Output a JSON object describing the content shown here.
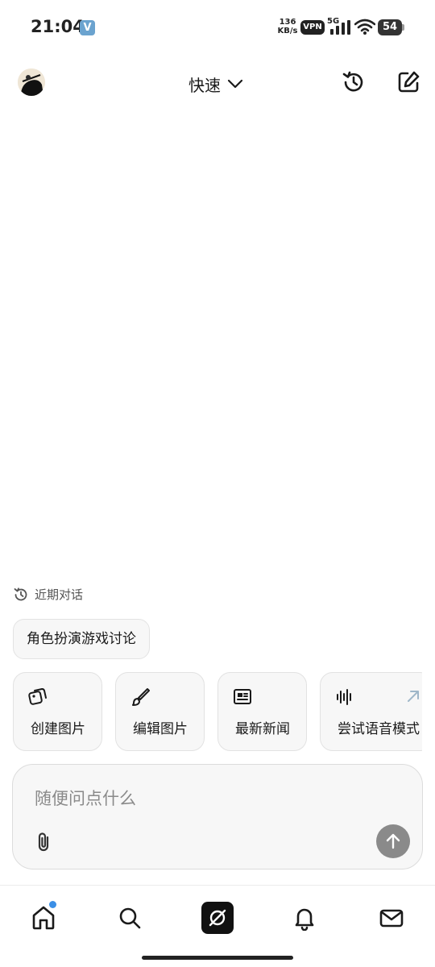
{
  "status_bar": {
    "time": "21:04",
    "v_badge": "V",
    "speed_value": "136",
    "speed_unit": "KB/s",
    "vpn": "VPN",
    "network": "5G",
    "battery": "54",
    "signal_icon": "signal-bars-icon",
    "wifi_icon": "wifi-icon"
  },
  "header": {
    "mode_label": "快速",
    "dropdown_icon": "chevron-down-icon",
    "history_icon": "history-icon",
    "new_chat_icon": "edit-icon"
  },
  "recent": {
    "label": "近期对话",
    "items": [
      "角色扮演游戏讨论"
    ]
  },
  "quick_actions": [
    {
      "label": "创建图片",
      "icon": "image-create-icon"
    },
    {
      "label": "编辑图片",
      "icon": "brush-icon"
    },
    {
      "label": "最新新闻",
      "icon": "newspaper-icon"
    },
    {
      "label": "尝试语音模式",
      "icon": "voice-wave-icon"
    }
  ],
  "composer": {
    "placeholder": "随便问点什么",
    "value": "",
    "attach_icon": "paperclip-icon",
    "send_icon": "arrow-up-icon"
  },
  "bottom_nav": [
    {
      "name": "home",
      "icon": "home-icon",
      "has_dot": true
    },
    {
      "name": "search",
      "icon": "search-icon"
    },
    {
      "name": "grok",
      "icon": "grok-logo-icon",
      "active": true
    },
    {
      "name": "notifications",
      "icon": "bell-icon"
    },
    {
      "name": "messages",
      "icon": "mail-icon"
    }
  ],
  "colors": {
    "accent_dot": "#3b8fe6",
    "send_button": "#8a8a8a",
    "card_bg": "#f7f7f7"
  }
}
